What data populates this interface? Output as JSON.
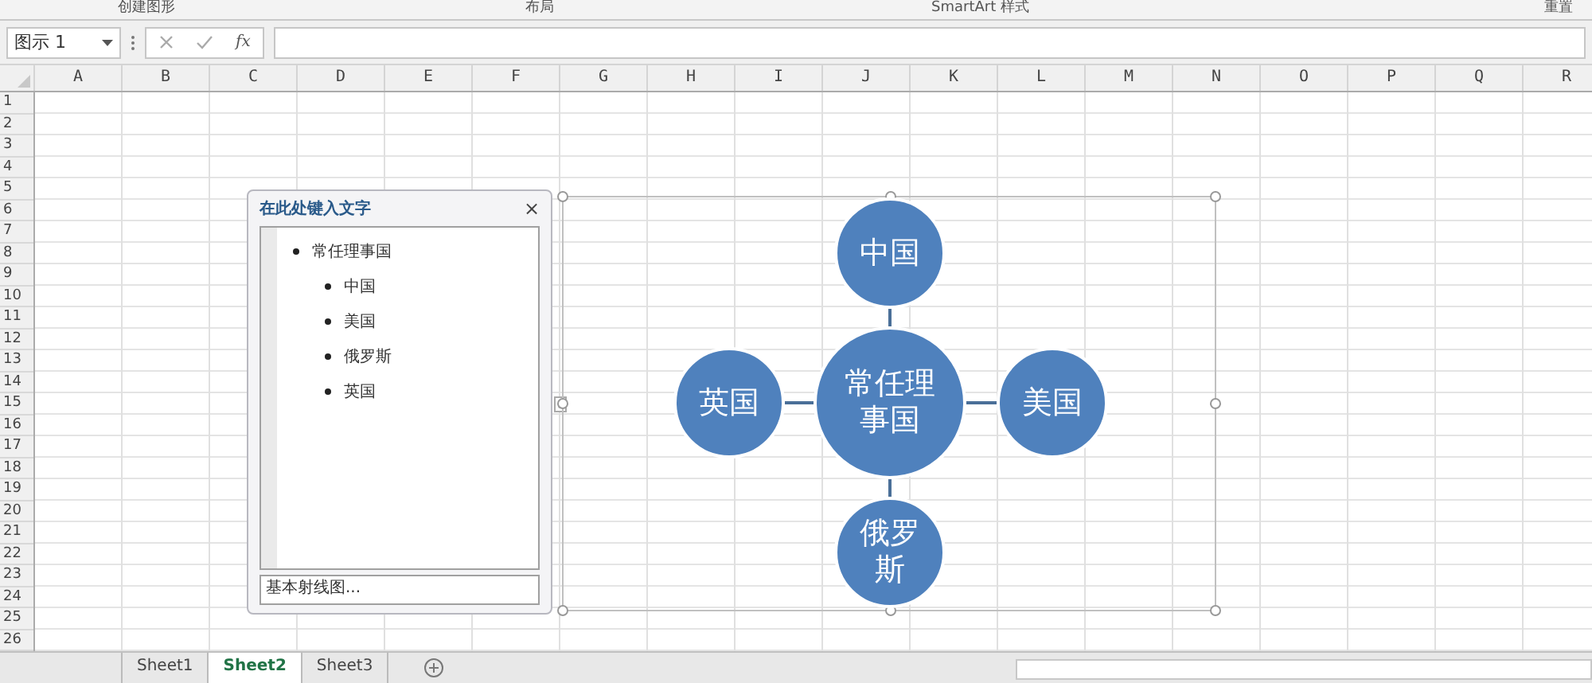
{
  "ribbon_groups": [
    "创建图形",
    "布局",
    "SmartArt 样式",
    "重置"
  ],
  "formula_bar": {
    "name_box": "图示 1",
    "function_label": "fx"
  },
  "columns": [
    "A",
    "B",
    "C",
    "D",
    "E",
    "F",
    "G",
    "H",
    "I",
    "J",
    "K",
    "L",
    "M",
    "N",
    "O",
    "P",
    "Q",
    "R"
  ],
  "rows": [
    "1",
    "2",
    "3",
    "4",
    "5",
    "6",
    "7",
    "8",
    "9",
    "10",
    "11",
    "12",
    "13",
    "14",
    "15",
    "16",
    "17",
    "18",
    "19",
    "20",
    "21",
    "22",
    "23",
    "24",
    "25",
    "26"
  ],
  "text_pane": {
    "title": "在此处键入文字",
    "close": "×",
    "items": [
      {
        "text": "常任理事国",
        "children": [
          {
            "text": "中国"
          },
          {
            "text": "美国"
          },
          {
            "text": "俄罗斯"
          },
          {
            "text": "英国"
          }
        ]
      }
    ],
    "footer": "基本射线图..."
  },
  "diagram": {
    "center": "常任理事国",
    "nodes": [
      {
        "text": "中国"
      },
      {
        "text": "英国"
      },
      {
        "text": "美国"
      },
      {
        "text": "俄罗斯"
      }
    ]
  },
  "sheet_tabs": [
    {
      "label": "Sheet1",
      "selected": false
    },
    {
      "label": "Sheet2",
      "selected": true
    },
    {
      "label": "Sheet3",
      "selected": false
    }
  ]
}
